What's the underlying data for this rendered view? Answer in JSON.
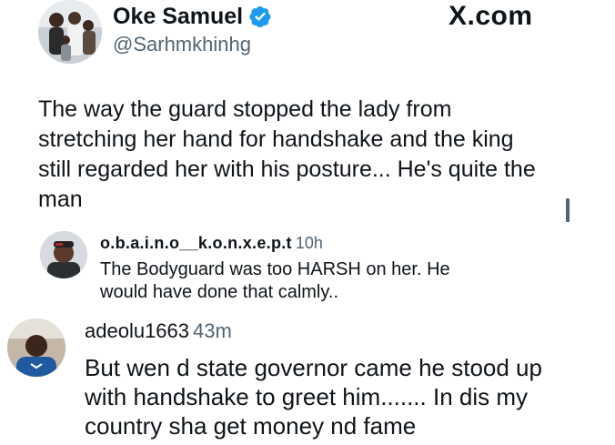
{
  "header": {
    "display_name": "Oke Samuel",
    "handle": "@Sarhmkhinhg",
    "site_label": "X.com",
    "verified_color": "#1d9bf0"
  },
  "tweet": {
    "lines": [
      "The way the guard stopped the lady from",
      "stretching her hand for handshake and the king",
      "still regarded her with his posture... He's quite the",
      "man"
    ]
  },
  "comments": [
    {
      "username": "o.b.a.i.n.o__k.o.n.x.e.p.t",
      "time": "10h",
      "lines": [
        "The Bodyguard was too HARSH on her. He",
        "would have done that calmly.."
      ]
    },
    {
      "username": "adeolu1663",
      "time": "43m",
      "lines": [
        "But wen d state governor came he stood up",
        "with handshake to greet him....... In dis my",
        "country sha get money nd fame"
      ]
    }
  ],
  "colors": {
    "text": "#0f1419",
    "secondary": "#536471",
    "accent": "#1d9bf0"
  }
}
